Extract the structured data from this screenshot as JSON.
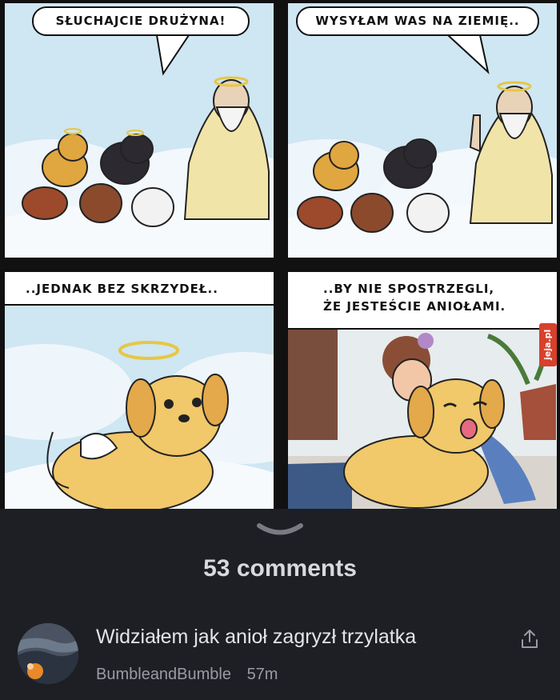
{
  "comic": {
    "panel1_bubble": "SŁUCHAJCIE DRUŻYNA!",
    "panel2_bubble": "WYSYŁAM WAS NA ZIEMIĘ..",
    "panel3_caption": "..JEDNAK BEZ SKRZYDEŁ..",
    "panel4_caption_line1": "..BY NIE SPOSTRZEGLI,",
    "panel4_caption_line2": "ŻE JESTEŚCIE ANIOŁAMI.",
    "watermark": "jeja.pl"
  },
  "comments": {
    "count_label": "53 comments",
    "items": [
      {
        "text": "Widziałem jak anioł zagryzł trzylatka",
        "author": "BumbleandBumble",
        "time": "57m"
      }
    ]
  },
  "icons": {
    "collapse": "chevron-down-icon",
    "share": "share-icon"
  },
  "colors": {
    "background": "#1e1f24",
    "comment_text": "#e4e4e8",
    "meta_text": "#9a9ba3",
    "watermark": "#d8402c"
  }
}
